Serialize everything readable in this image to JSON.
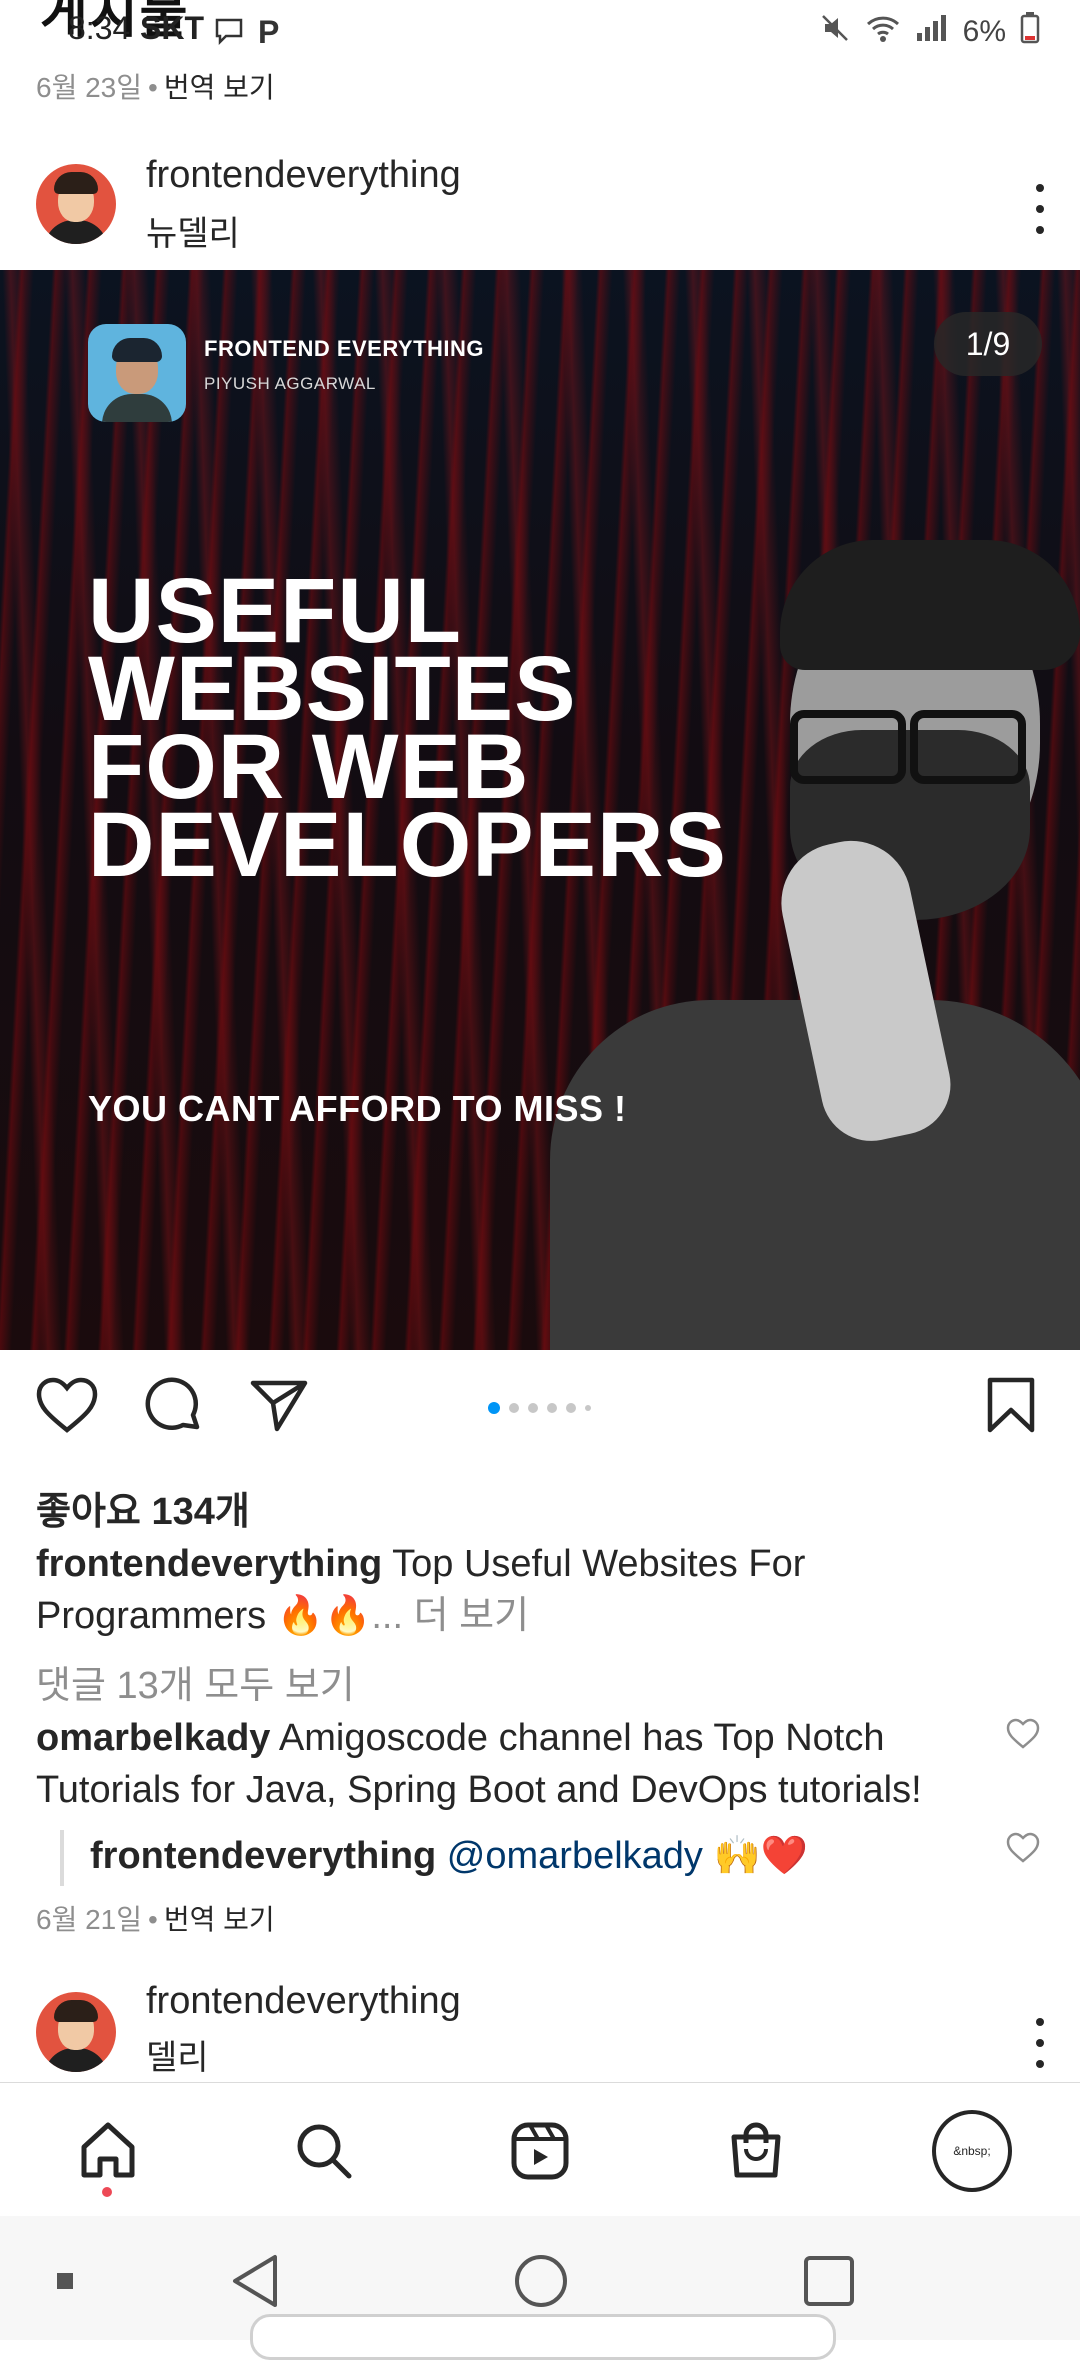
{
  "status_bar": {
    "time": "8:34",
    "carrier": "SKT",
    "battery": "6%",
    "icons": [
      "message-icon",
      "play-badge-icon",
      "mute-icon",
      "wifi-icon",
      "signal-icon",
      "battery-icon"
    ]
  },
  "header": {
    "partial_title": "게시물"
  },
  "previous_post": {
    "date": "6월 23일",
    "translate": "번역 보기"
  },
  "post": {
    "username": "frontendeverything",
    "location": "뉴델리",
    "image": {
      "brand_name": "FRONTEND EVERYTHING",
      "brand_sub": "PIYUSH AGGARWAL",
      "counter": "1/9",
      "headline": [
        "USEFUL",
        "WEBSITES",
        "FOR WEB",
        "DEVELOPERS"
      ],
      "subline": "YOU CANT AFFORD TO MISS !"
    },
    "likes": "좋아요 134개",
    "caption_user": "frontendeverything",
    "caption_text": " Top Useful Websites For Programmers ",
    "caption_emoji": "🔥🔥",
    "caption_more": "... 더 보기",
    "view_all_comments": "댓글 13개 모두 보기",
    "comment": {
      "user": "omarbelkady",
      "text": " Amigoscode channel has Top Notch Tutorials for Java, Spring Boot and DevOps tutorials!"
    },
    "reply": {
      "user": "frontendeverything",
      "mention": " @omarbelkady",
      "emoji": " 🙌❤️"
    },
    "date": "6월 21일",
    "translate": "번역 보기"
  },
  "next_post": {
    "username": "frontendeverything",
    "location": "델리"
  },
  "bottom_nav": {
    "items": [
      "home-icon",
      "search-icon",
      "reels-icon",
      "shop-icon",
      "profile"
    ],
    "profile_label": "&nbsp;"
  },
  "colors": {
    "accent": "#0095f6",
    "notification": "#ed4956",
    "text": "#262626",
    "muted": "#8e8e8e"
  }
}
